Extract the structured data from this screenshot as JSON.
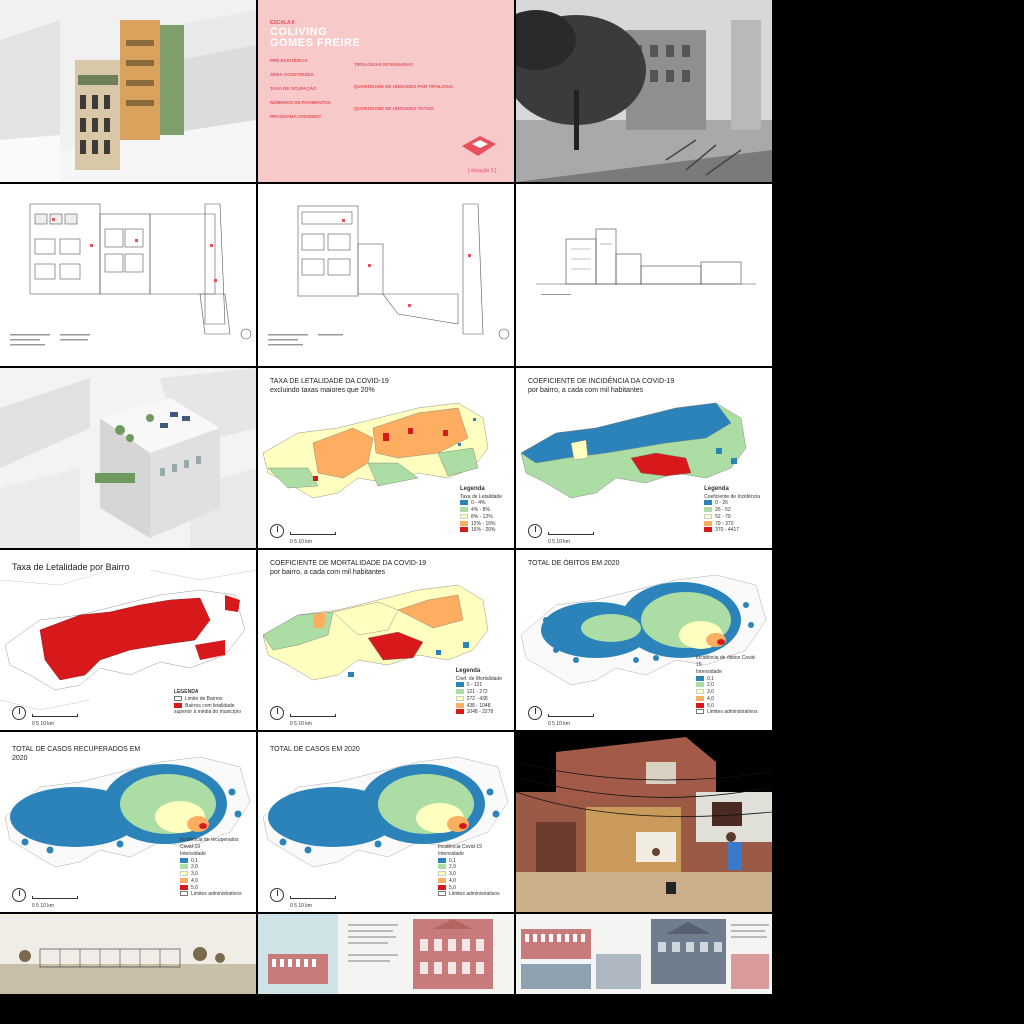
{
  "coliving": {
    "scale": "ESCALA II",
    "title_line1": "COLIVING",
    "title_line2": "GOMES FREIRE",
    "left_fields": [
      "PRÉ-EXISTÊNCIA",
      "ÁREA CONSTRUÍDA",
      "TAXA DE OCUPAÇÃO",
      "NÚMEROS DE PAVIMENTOS",
      "PROGRAMA ATENDIDO"
    ],
    "right_fields": [
      "TIPOLOGIAS INTEGRADAS",
      "QUANTIDADE DE UNIDADES POR TIPOLOGIA",
      "QUANTIDADE DE UNIDADES TOTAIS"
    ],
    "badge": "[ situação 3 ]"
  },
  "maps": {
    "letalidade": {
      "title_line1": "TAXA DE LETALIDADE DA COVID-19",
      "title_line2": "excluindo taxas maiores que 20%",
      "legend_title": "Legenda",
      "legend_sub": "Taxa de Letalidade",
      "classes": [
        "0 - 4%",
        "4% - 8%",
        "8% - 12%",
        "12% - 16%",
        "16% - 20%"
      ],
      "class_colors": [
        "#2b83ba",
        "#abdda4",
        "#ffffbf",
        "#fdae61",
        "#d7191c"
      ]
    },
    "incidencia": {
      "title_line1": "COEFICIENTE DE INCIDÊNCIA DA COVID-19",
      "title_line2": "por bairro, a cada com mil habitantes",
      "legend_title": "Legenda",
      "legend_sub": "Coeficiente de Incidência",
      "classes": [
        "0 - 26",
        "26 - 52",
        "52 - 79",
        "79 - 370",
        "370 - 4417"
      ],
      "class_colors": [
        "#2b83ba",
        "#abdda4",
        "#ffffbf",
        "#fdae61",
        "#d7191c"
      ]
    },
    "letalidade_bairro": {
      "title": "Taxa de Letalidade por Bairro",
      "legend_title": "LEGENDA",
      "legend_items": [
        "Limite de Bairros",
        "Bairros com letalidade superior à média do município"
      ],
      "highlight_color": "#d7191c"
    },
    "mortalidade": {
      "title_line1": "COEFICIENTE DE MORTALIDADE DA COVID-19",
      "title_line2": "por bairro, a cada com mil habitantes",
      "legend_title": "Legenda",
      "legend_sub": "Coef. de Mortalidade",
      "classes": [
        "0 - 121",
        "121 - 272",
        "272 - 438",
        "438 - 1048",
        "1048 - 2279"
      ],
      "class_colors": [
        "#2b83ba",
        "#abdda4",
        "#ffffbf",
        "#fdae61",
        "#d7191c"
      ]
    },
    "obitos": {
      "title": "TOTAL DE ÓBITOS EM 2020",
      "legend_title": "Incidência de óbitos Covid-19",
      "legend_sub": "Intensidade",
      "classes": [
        "0,1",
        "2,0",
        "3,0",
        "4,0",
        "5,0"
      ],
      "extra": "Limites administrativos"
    },
    "recuperados": {
      "title_line1": "TOTAL DE CASOS RECUPERADOS EM",
      "title_line2": "2020",
      "legend_title": "Incidência de recuperados Covid-19",
      "legend_sub": "Intensidade",
      "classes": [
        "0,1",
        "2,0",
        "3,0",
        "4,0",
        "5,0"
      ],
      "extra": "Limites administrativos"
    },
    "casos": {
      "title": "TOTAL DE CASOS EM 2020",
      "legend_title": "Incidência Covid-19",
      "legend_sub": "Intensidade",
      "classes": [
        "0,1",
        "2,0",
        "3,0",
        "4,0",
        "5,0"
      ],
      "extra": "Limites administrativos"
    },
    "scale_label": "0     5       10 km"
  },
  "colors": {
    "pink_bg": "#f7c9c9",
    "pink_text": "#e8515b",
    "heat_blue": "#2b83ba",
    "heat_green": "#abdda4",
    "heat_yellow": "#ffffbf",
    "heat_orange": "#fdae61",
    "heat_red": "#d7191c",
    "brick": "#9a5a45",
    "facade": "#c97b7b"
  }
}
